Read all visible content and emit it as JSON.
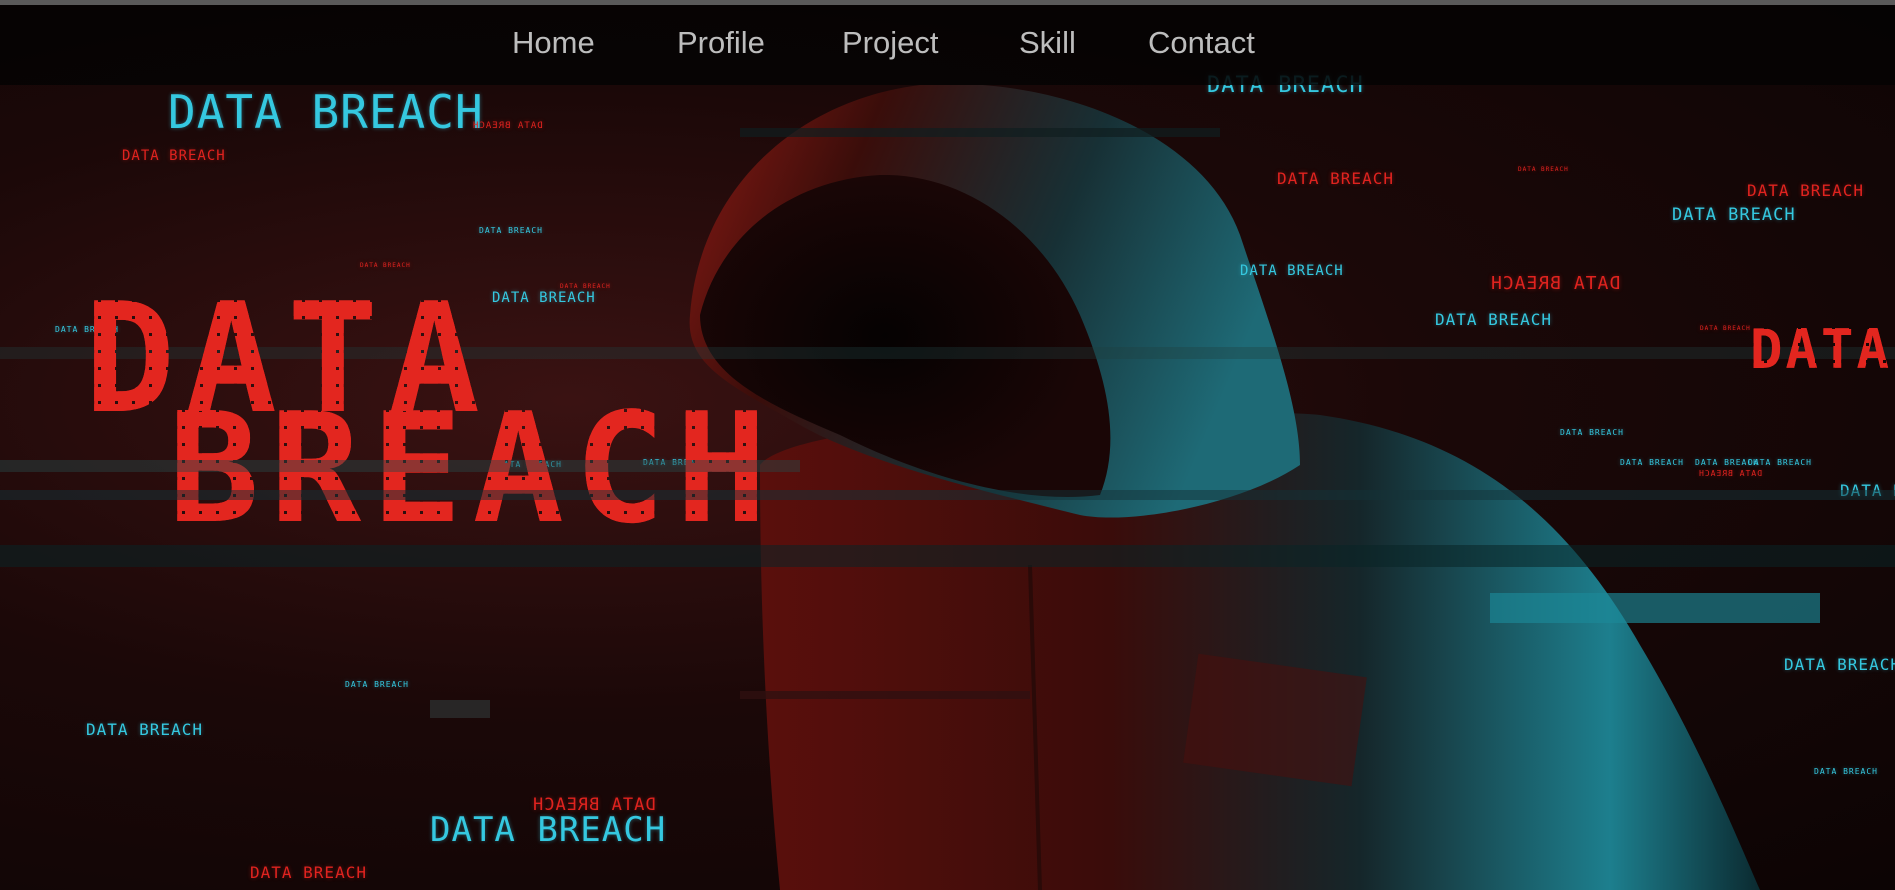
{
  "nav": {
    "home": "Home",
    "profile": "Profile",
    "project": "Project",
    "skill": "Skill",
    "contact": "Contact"
  },
  "hero": {
    "main_word_1": "DATA",
    "main_word_2": "BREACH",
    "right_big_word": "DATA",
    "tag": "DATA BREACH"
  },
  "colors": {
    "accent_cyan": "#35c8e0",
    "accent_red": "#e0231f",
    "nav_text": "#bdbdbd",
    "background": "#0d0505"
  }
}
